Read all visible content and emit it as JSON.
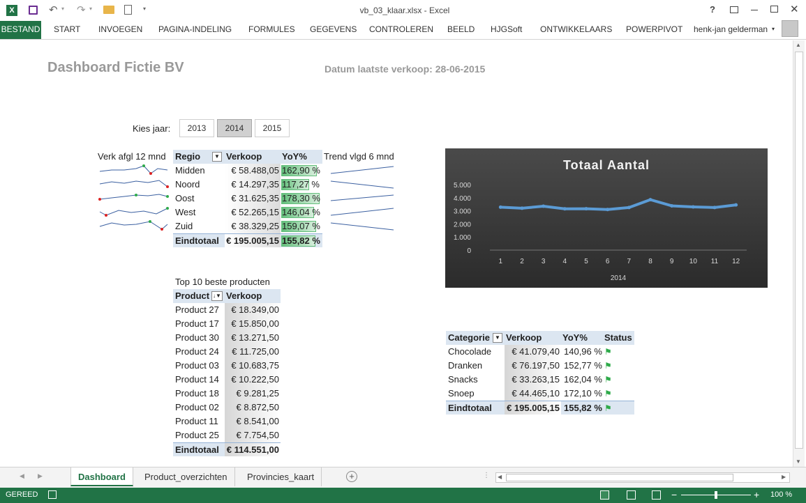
{
  "window": {
    "title": "vb_03_klaar.xlsx - Excel",
    "user": "henk-jan gelderman"
  },
  "ribbon": {
    "tabs": [
      "BESTAND",
      "START",
      "INVOEGEN",
      "PAGINA-INDELING",
      "FORMULES",
      "GEGEVENS",
      "CONTROLEREN",
      "BEELD",
      "HJGSoft",
      "ONTWIKKELAARS",
      "POWERPIVOT"
    ]
  },
  "dashboard": {
    "title": "Dashboard Fictie BV",
    "last_sale": "Datum laatste verkoop: 28-06-2015",
    "year_label": "Kies jaar:",
    "years": [
      "2013",
      "2014",
      "2015"
    ],
    "selected_year": "2014",
    "spark_left_label": "Verk afgl 12 mnd",
    "spark_right_label": "Trend vlgd 6 mnd"
  },
  "region_table": {
    "headers": [
      "Regio",
      "Verkoop",
      "YoY%"
    ],
    "rows": [
      {
        "name": "Midden",
        "sales": "€ 58.488,05",
        "yoy": "162,90 %",
        "pct": 0.91
      },
      {
        "name": "Noord",
        "sales": "€ 14.297,35",
        "yoy": "117,27 %",
        "pct": 0.72
      },
      {
        "name": "Oost",
        "sales": "€ 31.625,35",
        "yoy": "178,30 %",
        "pct": 0.98
      },
      {
        "name": "West",
        "sales": "€ 52.265,15",
        "yoy": "146,04 %",
        "pct": 0.84
      },
      {
        "name": "Zuid",
        "sales": "€ 38.329,25",
        "yoy": "159,07 %",
        "pct": 0.89
      }
    ],
    "total": {
      "name": "Eindtotaal",
      "sales": "€ 195.005,15",
      "yoy": "155,82 %",
      "pct": 0.88
    }
  },
  "product_table": {
    "caption": "Top 10 beste producten",
    "headers": [
      "Product",
      "Verkoop"
    ],
    "rows": [
      {
        "name": "Product 27",
        "sales": "€ 18.349,00"
      },
      {
        "name": "Product 17",
        "sales": "€ 15.850,00"
      },
      {
        "name": "Product 30",
        "sales": "€ 13.271,50"
      },
      {
        "name": "Product 24",
        "sales": "€ 11.725,00"
      },
      {
        "name": "Product 03",
        "sales": "€ 10.683,75"
      },
      {
        "name": "Product 14",
        "sales": "€ 10.222,50"
      },
      {
        "name": "Product 18",
        "sales": "€ 9.281,25"
      },
      {
        "name": "Product 02",
        "sales": "€ 8.872,50"
      },
      {
        "name": "Product 11",
        "sales": "€ 8.541,00"
      },
      {
        "name": "Product 25",
        "sales": "€ 7.754,50"
      }
    ],
    "total": {
      "name": "Eindtotaal",
      "sales": "€ 114.551,00"
    }
  },
  "category_table": {
    "headers": [
      "Categorie",
      "Verkoop",
      "YoY%",
      "Status"
    ],
    "rows": [
      {
        "name": "Chocolade",
        "sales": "€ 41.079,40",
        "yoy": "140,96 %"
      },
      {
        "name": "Dranken",
        "sales": "€ 76.197,50",
        "yoy": "152,77 %"
      },
      {
        "name": "Snacks",
        "sales": "€ 33.263,15",
        "yoy": "162,04 %"
      },
      {
        "name": "Snoep",
        "sales": "€ 44.465,10",
        "yoy": "172,10 %"
      }
    ],
    "total": {
      "name": "Eindtotaal",
      "sales": "€ 195.005,15",
      "yoy": "155,82 %"
    }
  },
  "chart_data": {
    "type": "line",
    "title": "Totaal Aantal",
    "xlabel": "2014",
    "ylabel": "",
    "categories": [
      "1",
      "2",
      "3",
      "4",
      "5",
      "6",
      "7",
      "8",
      "9",
      "10",
      "11",
      "12"
    ],
    "y_ticks": [
      "5.000",
      "4.000",
      "3.000",
      "2.000",
      "1.000",
      "0"
    ],
    "ylim": [
      0,
      5000
    ],
    "series": [
      {
        "values": [
          3280,
          3200,
          3350,
          3150,
          3160,
          3100,
          3250,
          3850,
          3380,
          3300,
          3250,
          3450
        ]
      }
    ],
    "grid": false,
    "colors": {
      "line": "#5b9bd5",
      "background": "#3a3a3a"
    }
  },
  "sheets": {
    "tabs": [
      "Dashboard",
      "Product_overzichten",
      "Provincies_kaart"
    ],
    "active": "Dashboard"
  },
  "status": {
    "ready": "GEREED",
    "zoom": "100 %"
  }
}
